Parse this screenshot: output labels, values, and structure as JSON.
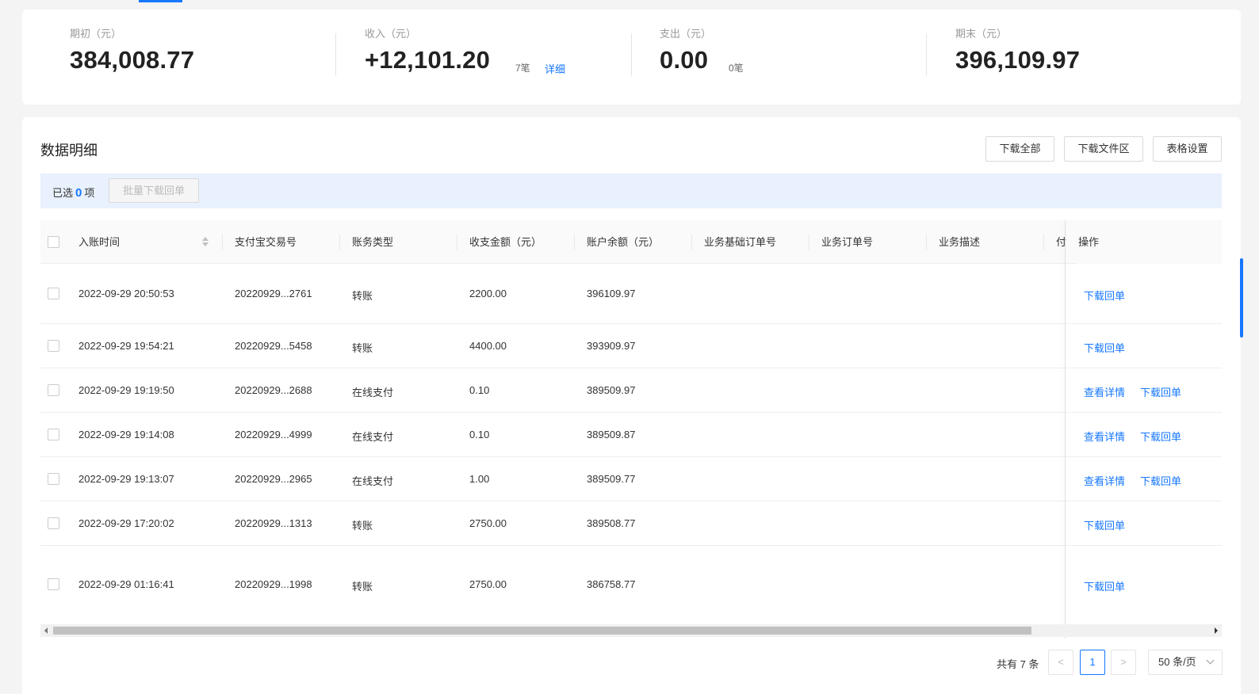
{
  "summary": {
    "opening": {
      "label": "期初（元）",
      "value": "384,008.77"
    },
    "income": {
      "label": "收入（元）",
      "value": "+12,101.20",
      "count": "7笔",
      "detail_link": "详细"
    },
    "expense": {
      "label": "支出（元）",
      "value": "0.00",
      "count": "0笔"
    },
    "closing": {
      "label": "期末（元）",
      "value": "396,109.97"
    }
  },
  "detail": {
    "title": "数据明细",
    "buttons": {
      "download_all": "下载全部",
      "download_area": "下载文件区",
      "table_settings": "表格设置"
    },
    "selection": {
      "prefix": "已选",
      "count": "0",
      "suffix": "项",
      "batch_button": "批量下载回单"
    }
  },
  "table": {
    "columns": {
      "time": "入账时间",
      "trade_no": "支付宝交易号",
      "type": "账务类型",
      "amount": "收支金额（元）",
      "balance": "账户余额（元）",
      "base_order": "业务基础订单号",
      "order": "业务订单号",
      "desc": "业务描述",
      "partial": "付",
      "action": "操作"
    },
    "rows": [
      {
        "time": "2022-09-29 20:50:53",
        "trade_no": "20220929...2761",
        "type": "转账",
        "amount": "2200.00",
        "balance": "396109.97",
        "actions": [
          "下载回单"
        ]
      },
      {
        "time": "2022-09-29 19:54:21",
        "trade_no": "20220929...5458",
        "type": "转账",
        "amount": "4400.00",
        "balance": "393909.97",
        "actions": [
          "下载回单"
        ]
      },
      {
        "time": "2022-09-29 19:19:50",
        "trade_no": "20220929...2688",
        "type": "在线支付",
        "amount": "0.10",
        "balance": "389509.97",
        "actions": [
          "查看详情",
          "下载回单"
        ]
      },
      {
        "time": "2022-09-29 19:14:08",
        "trade_no": "20220929...4999",
        "type": "在线支付",
        "amount": "0.10",
        "balance": "389509.87",
        "actions": [
          "查看详情",
          "下载回单"
        ]
      },
      {
        "time": "2022-09-29 19:13:07",
        "trade_no": "20220929...2965",
        "type": "在线支付",
        "amount": "1.00",
        "balance": "389509.77",
        "actions": [
          "查看详情",
          "下载回单"
        ]
      },
      {
        "time": "2022-09-29 17:20:02",
        "trade_no": "20220929...1313",
        "type": "转账",
        "amount": "2750.00",
        "balance": "389508.77",
        "actions": [
          "下载回单"
        ]
      },
      {
        "time": "2022-09-29 01:16:41",
        "trade_no": "20220929...1998",
        "type": "转账",
        "amount": "2750.00",
        "balance": "386758.77",
        "actions": [
          "下载回单"
        ]
      }
    ]
  },
  "pagination": {
    "total": "共有 7 条",
    "current_page": "1",
    "prev": "<",
    "next": ">",
    "page_size": "50 条/页"
  },
  "colors": {
    "accent": "#1677ff",
    "selection_bg": "#e8f1fd"
  }
}
